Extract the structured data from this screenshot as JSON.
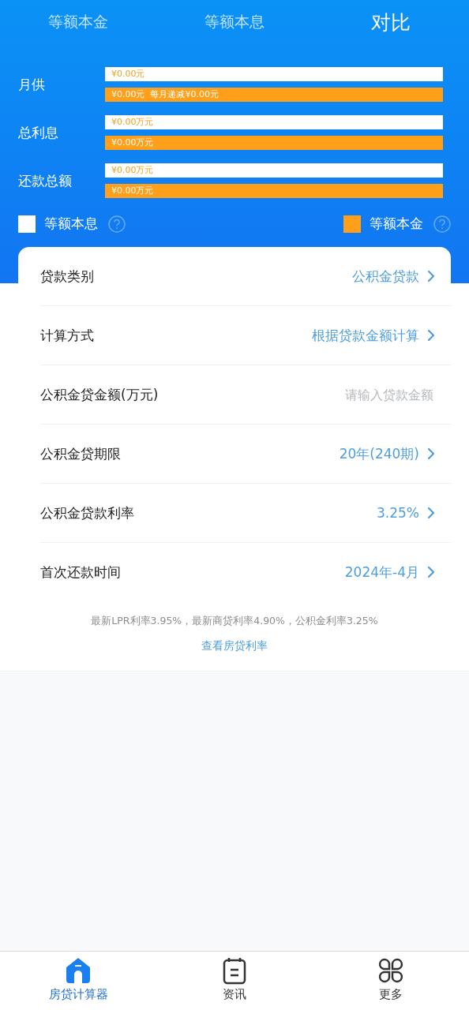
{
  "tabs": [
    {
      "label": "等额本金",
      "selected": false
    },
    {
      "label": "等额本息",
      "selected": false
    },
    {
      "label": "对比",
      "selected": true
    }
  ],
  "comparison": [
    {
      "label": "月供",
      "bars": [
        {
          "kind": "installment",
          "text": "¥0.00元"
        },
        {
          "kind": "principal",
          "text": "¥0.00元  每月递减¥0.00元"
        }
      ]
    },
    {
      "label": "总利息",
      "bars": [
        {
          "kind": "installment",
          "text": "¥0.00万元"
        },
        {
          "kind": "principal",
          "text": "¥0.00万元"
        }
      ]
    },
    {
      "label": "还款总额",
      "bars": [
        {
          "kind": "installment",
          "text": "¥0.00万元"
        },
        {
          "kind": "principal",
          "text": "¥0.00万元"
        }
      ]
    }
  ],
  "legend": [
    {
      "label": "等额本息",
      "color": "#ffffff"
    },
    {
      "label": "等额本金",
      "color": "#ff9f1a"
    }
  ],
  "form": [
    {
      "kind": "select",
      "label": "贷款类别",
      "value": "公积金贷款"
    },
    {
      "kind": "select",
      "label": "计算方式",
      "value": "根据贷款金额计算"
    },
    {
      "kind": "input",
      "label": "公积金贷金额(万元)",
      "placeholder": "请输入贷款金额"
    },
    {
      "kind": "select",
      "label": "公积金贷期限",
      "value": "20年(240期)"
    },
    {
      "kind": "select",
      "label": "公积金贷款利率",
      "value": "3.25%"
    },
    {
      "kind": "select",
      "label": "首次还款时间",
      "value": "2024年-4月"
    }
  ],
  "rate_note": "最新LPR利率3.95%，最新商贷利率4.90%，公积金利率3.25%",
  "rate_link": "查看房贷利率",
  "bottom_nav": [
    {
      "label": "房贷计算器",
      "kind": "house",
      "selected": true
    },
    {
      "label": "资讯",
      "kind": "notepad",
      "selected": false
    },
    {
      "label": "更多",
      "kind": "grid",
      "selected": false
    }
  ]
}
